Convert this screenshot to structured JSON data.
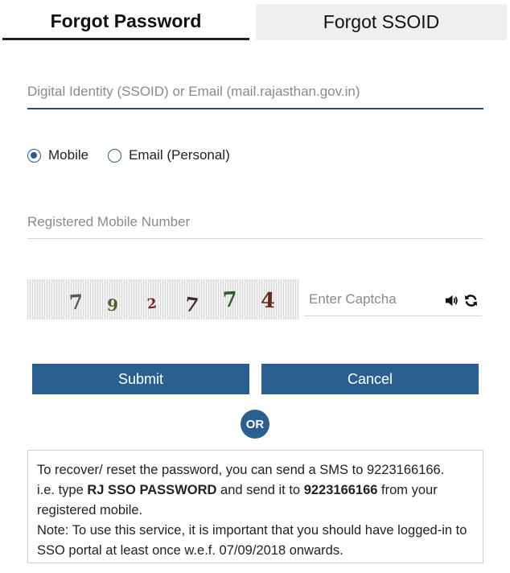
{
  "tabs": {
    "active": "Forgot Password",
    "inactive": "Forgot SSOID"
  },
  "form": {
    "ssoid_placeholder": "Digital Identity (SSOID) or Email (mail.rajasthan.gov.in)",
    "radio_mobile": "Mobile",
    "radio_email": "Email (Personal)",
    "selected_radio": "Mobile",
    "mobile_placeholder": "Registered Mobile Number",
    "captcha_placeholder": "Enter Captcha"
  },
  "captcha": {
    "digits": [
      "7",
      "9",
      "2",
      "7",
      "7",
      "4"
    ],
    "colors": [
      "#4f5a5a",
      "#5a5a2e",
      "#7a1f2e",
      "#4a1f2e",
      "#2f5a2a",
      "#6a2a1a"
    ]
  },
  "icons": {
    "audio": "speaker-icon",
    "refresh": "refresh-icon"
  },
  "buttons": {
    "submit": "Submit",
    "cancel": "Cancel"
  },
  "divider": {
    "or": "OR"
  },
  "info": {
    "line1": "To recover/ reset the password, you can send a SMS to 9223166166.",
    "pre_keyword": "i.e. type ",
    "keyword": "RJ SSO PASSWORD",
    "mid": " and send it to ",
    "number": "9223166166",
    "post": " from your registered mobile.",
    "note": "Note: To use this service, it is important that you should have logged-in to SSO portal at least once w.e.f. 07/09/2018 onwards."
  },
  "colors": {
    "primary": "#2b5f8f",
    "tab_inactive_bg": "#efefef",
    "underline_active": "#2a4f6e"
  }
}
